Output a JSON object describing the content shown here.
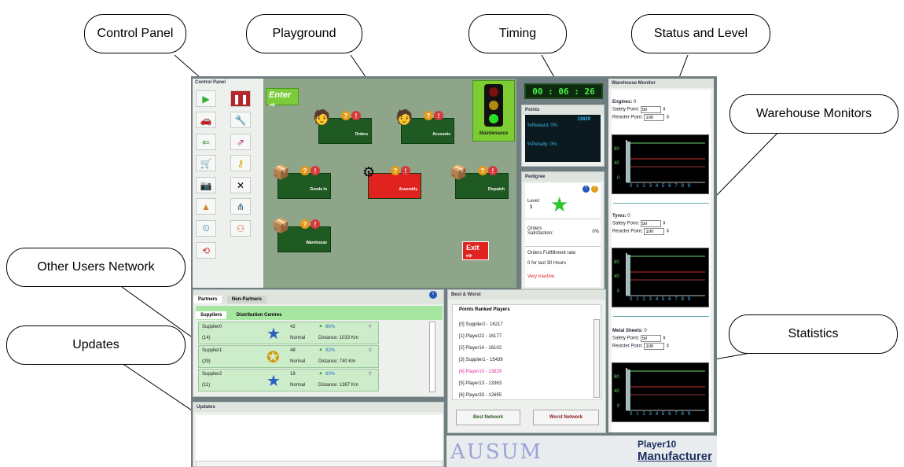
{
  "callouts": {
    "control_panel": "Control Panel",
    "playground": "Playground",
    "timing": "Timing",
    "status_level": "Status and Level",
    "warehouse_monitors": "Warehouse Monitors",
    "other_users": "Other Users Network",
    "updates": "Updates",
    "statistics": "Statistics"
  },
  "control_panel": {
    "title": "Control Panel",
    "buttons": [
      "play-icon",
      "pause-icon",
      "truck-icon",
      "wrench-tool-icon",
      "export-icon",
      "import-icon",
      "cart-icon",
      "key-icon",
      "camera-icon",
      "tools-icon",
      "shapes-icon",
      "network-icon",
      "clock-icon",
      "people-icon",
      "refresh-icon"
    ]
  },
  "playground": {
    "enter_label": "Enter",
    "departments": [
      {
        "label": "Orders",
        "color": "green"
      },
      {
        "label": "Accounts",
        "color": "green"
      },
      {
        "label": "Goods In",
        "color": "green"
      },
      {
        "label": "Assembly",
        "color": "red"
      },
      {
        "label": "Dispatch",
        "color": "green"
      },
      {
        "label": "Warehouse",
        "color": "green"
      }
    ],
    "maintenance_label": "Maintenance",
    "exit_label": "Exit"
  },
  "timer": "00 : 06 : 26",
  "points": {
    "title": "Points",
    "value": "13829",
    "reward": "%Reward: 0%",
    "penalty": "%Penalty: 0%"
  },
  "pedigree": {
    "title": "Pedigree",
    "level_label": "Level:",
    "level_value": "1",
    "orders_satisfaction_label": "Orders Satisfaction:",
    "orders_satisfaction_value": "0%",
    "fulfillment_label": "Orders Fullfillment rate:",
    "fulfillment_value": "0 for last 30 Hours",
    "status": "Very Inactive"
  },
  "warehouse": {
    "title": "Warehouse Monitor",
    "items": [
      {
        "name": "Engines:",
        "count": "0",
        "safety_label": "Safety Point:",
        "safety": "50",
        "reorder_label": "Reorder Point:",
        "reorder": "100",
        "ticks": [
          "80",
          "40",
          "0"
        ]
      },
      {
        "name": "Tyres:",
        "count": "0",
        "safety_label": "Safety Point:",
        "safety": "50",
        "reorder_label": "Reorder Point:",
        "reorder": "100",
        "ticks": [
          "80",
          "40",
          "0"
        ]
      },
      {
        "name": "Metal Sheets:",
        "count": "0",
        "safety_label": "Safety Point:",
        "safety": "50",
        "reorder_label": "Reorder Point:",
        "reorder": "100",
        "ticks": [
          "80",
          "40",
          "0"
        ]
      }
    ],
    "x_ticks": "0 1 2 3 4 5 6 7 8 9"
  },
  "network": {
    "tab_partners": "Partners",
    "tab_non_partners": "Non-Partners",
    "subtab_suppliers": "Suppliers",
    "subtab_distribution": "Distribution Centres",
    "rows": [
      {
        "name": "Supplier0",
        "id": "(14)",
        "score": "42",
        "status": "Normal",
        "pct": "86%",
        "distance": "Distance: 1033 Km"
      },
      {
        "name": "Supplier1",
        "id": "(29)",
        "score": "48",
        "status": "Normal",
        "pct": "92%",
        "distance": "Distance: 740 Km"
      },
      {
        "name": "Supplier2",
        "id": "(11)",
        "score": "18",
        "status": "Normal",
        "pct": "60%",
        "distance": "Distance: 1387 Km"
      }
    ]
  },
  "updates": {
    "title": "Updates"
  },
  "best_worst": {
    "title": "Best & Worst",
    "list_title": "Points Ranked Players",
    "players": [
      "[0] Supplier2 - 16217",
      "[1] Player22 - 16177",
      "[2] Player14 - 16102",
      "[3] Supplier1 - 15439",
      "[4] Player10 - 13829",
      "[5] Player13 - 13363",
      "[6] Player33 - 12695"
    ],
    "best_button": "Best Network",
    "worst_button": "Worst Network"
  },
  "brand": "AUSUM",
  "player": {
    "name": "Player10",
    "role": "Manufacturer"
  },
  "colors": {
    "panel_bg": "#6f7e80",
    "playground": "#8fa58a",
    "dept_green": "#1f5a22",
    "dept_red": "#e0231e",
    "highlight": "#e0309a"
  }
}
